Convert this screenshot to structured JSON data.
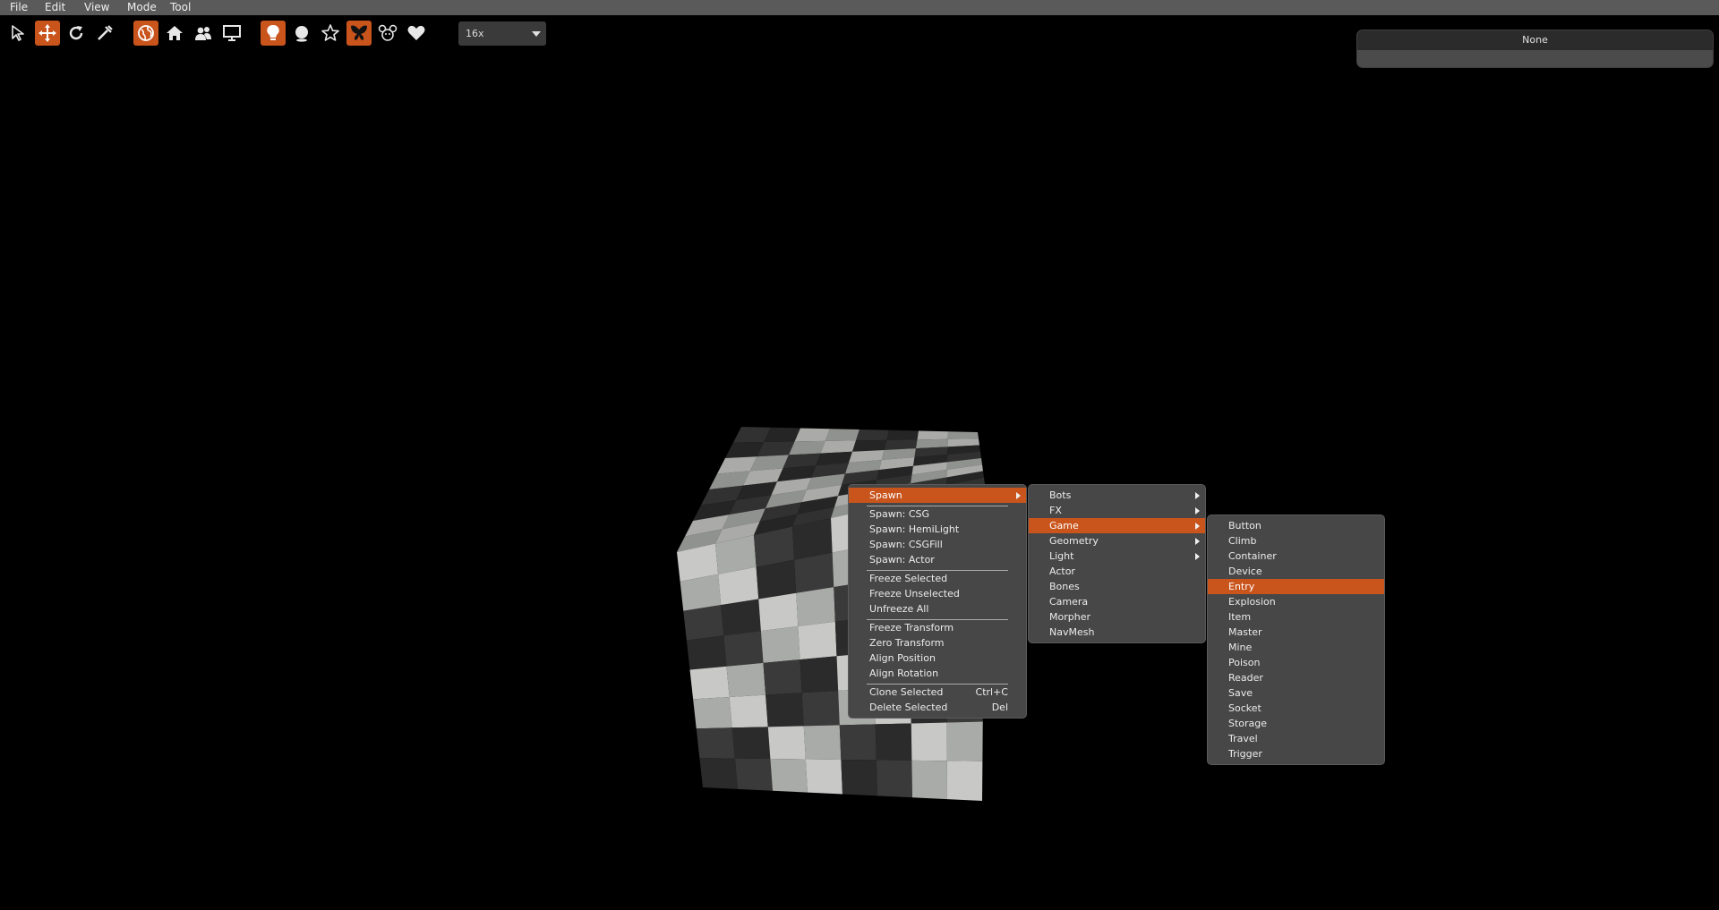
{
  "menubar": {
    "items": [
      "File",
      "Edit",
      "View",
      "Mode",
      "Tool"
    ]
  },
  "toolbar": {
    "colors": {
      "accent": "#c9541c",
      "icon": "#e8e8e8"
    },
    "tools": [
      {
        "icon": "select-arrow-icon",
        "active": false
      },
      {
        "icon": "move-icon",
        "active": true
      },
      {
        "icon": "rotate-icon",
        "active": false
      },
      {
        "icon": "scale-icon",
        "active": false
      },
      {
        "icon": "globe-icon",
        "active": true
      },
      {
        "icon": "home-icon",
        "active": false
      },
      {
        "icon": "users-icon",
        "active": false
      },
      {
        "icon": "monitor-icon",
        "active": false
      },
      {
        "icon": "lightbulb-icon",
        "active": true
      },
      {
        "icon": "sphere-icon",
        "active": false
      },
      {
        "icon": "star-icon",
        "active": false
      },
      {
        "icon": "butterfly-icon",
        "active": true
      },
      {
        "icon": "mouse-icon",
        "active": false
      },
      {
        "icon": "heart-icon",
        "active": false
      }
    ],
    "zoom": {
      "value": "16x"
    }
  },
  "selection_panel": {
    "title": "None"
  },
  "context_menu": {
    "items": [
      {
        "label": "Spawn",
        "submenu": true,
        "highlighted": true
      },
      {
        "separator": true
      },
      {
        "label": "Spawn: CSG"
      },
      {
        "label": "Spawn: HemiLight"
      },
      {
        "label": "Spawn: CSGFill"
      },
      {
        "label": "Spawn: Actor"
      },
      {
        "separator": true
      },
      {
        "label": "Freeze Selected"
      },
      {
        "label": "Freeze Unselected"
      },
      {
        "label": "Unfreeze All"
      },
      {
        "separator": true
      },
      {
        "label": "Freeze Transform"
      },
      {
        "label": "Zero Transform"
      },
      {
        "label": "Align Position"
      },
      {
        "label": "Align Rotation"
      },
      {
        "separator": true
      },
      {
        "label": "Clone Selected",
        "shortcut": "Ctrl+C"
      },
      {
        "label": "Delete Selected",
        "shortcut": "Del"
      }
    ]
  },
  "spawn_menu": {
    "items": [
      {
        "label": "Bots",
        "submenu": true
      },
      {
        "label": "FX",
        "submenu": true
      },
      {
        "label": "Game",
        "submenu": true,
        "highlighted": true
      },
      {
        "label": "Geometry",
        "submenu": true
      },
      {
        "label": "Light",
        "submenu": true
      },
      {
        "label": "Actor"
      },
      {
        "label": "Bones"
      },
      {
        "label": "Camera"
      },
      {
        "label": "Morpher"
      },
      {
        "label": "NavMesh"
      }
    ]
  },
  "game_menu": {
    "items": [
      {
        "label": "Button"
      },
      {
        "label": "Climb"
      },
      {
        "label": "Container"
      },
      {
        "label": "Device"
      },
      {
        "label": "Entry",
        "highlighted": true
      },
      {
        "label": "Explosion"
      },
      {
        "label": "Item"
      },
      {
        "label": "Master"
      },
      {
        "label": "Mine"
      },
      {
        "label": "Poison"
      },
      {
        "label": "Reader"
      },
      {
        "label": "Save"
      },
      {
        "label": "Socket"
      },
      {
        "label": "Storage"
      },
      {
        "label": "Travel"
      },
      {
        "label": "Trigger"
      }
    ]
  }
}
